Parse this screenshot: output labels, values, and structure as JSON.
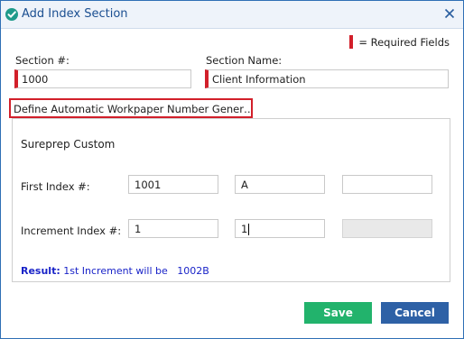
{
  "dialog": {
    "title": "Add Index Section",
    "logo_icon": "checkmark-shield-icon",
    "close_icon": "close-icon"
  },
  "legend": {
    "required_text": "= Required Fields"
  },
  "form": {
    "section_number_label": "Section #:",
    "section_number_value": "1000",
    "section_name_label": "Section Name:",
    "section_name_value": "Client Information"
  },
  "auto_number": {
    "header": "Define Automatic Workpaper Number Gener…",
    "preset_name": "Sureprep Custom",
    "first_index_label": "First Index #:",
    "first_index_values": [
      "1001",
      "A",
      ""
    ],
    "increment_label": "Increment Index #:",
    "increment_values": [
      "1",
      "1",
      ""
    ],
    "result_label": "Result:",
    "result_text": "1st Increment will be",
    "result_value": "1002B"
  },
  "buttons": {
    "save": "Save",
    "cancel": "Cancel"
  },
  "colors": {
    "required": "#d21f2a",
    "save": "#22b36c",
    "cancel": "#2e61a6",
    "result": "#1a24c8"
  }
}
